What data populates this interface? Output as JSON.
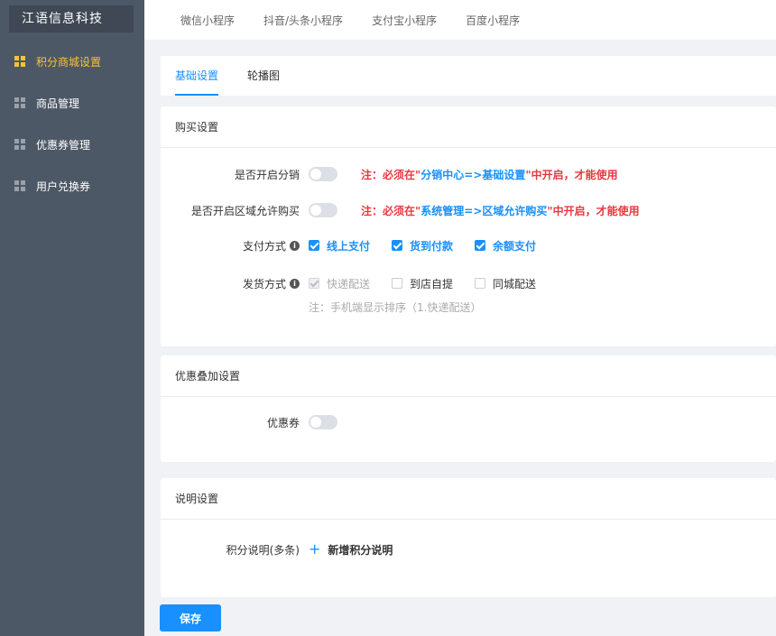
{
  "brand": {
    "title": "江语信息科技"
  },
  "sidebar": {
    "items": [
      {
        "label": "积分商城设置"
      },
      {
        "label": "商品管理"
      },
      {
        "label": "优惠券管理"
      },
      {
        "label": "用户兑换券"
      }
    ]
  },
  "topbar": {
    "tabs": [
      {
        "label": "微信小程序"
      },
      {
        "label": "抖音/头条小程序"
      },
      {
        "label": "支付宝小程序"
      },
      {
        "label": "百度小程序"
      }
    ]
  },
  "subtabs": [
    {
      "label": "基础设置"
    },
    {
      "label": "轮播图"
    }
  ],
  "purchase": {
    "title": "购买设置",
    "distribution": {
      "label": "是否开启分销",
      "note_pre": "注：必须在\"",
      "note_link": "分销中心=>基础设置",
      "note_post": "\"中开启，才能使用"
    },
    "region": {
      "label": "是否开启区域允许购买",
      "note_pre": "注：必须在\"",
      "note_link": "系统管理=>区域允许购买",
      "note_post": "\"中开启，才能使用"
    },
    "payment": {
      "label": "支付方式",
      "options": [
        {
          "label": "线上支付"
        },
        {
          "label": "货到付款"
        },
        {
          "label": "余额支付"
        }
      ]
    },
    "delivery": {
      "label": "发货方式",
      "options": [
        {
          "label": "快递配送"
        },
        {
          "label": "到店自提"
        },
        {
          "label": "同城配送"
        }
      ],
      "hint": "注：手机端显示排序（1.快递配送）"
    }
  },
  "discount": {
    "title": "优惠叠加设置",
    "coupon_label": "优惠券"
  },
  "description": {
    "title": "说明设置",
    "points_label": "积分说明(多条)",
    "add_label": "新增积分说明",
    "add_icon": "+"
  },
  "save_button": {
    "label": "保存"
  },
  "colors": {
    "primary": "#1890ff",
    "sidebar": "#4d5866",
    "active": "#f9c335",
    "warning": "#e8383d"
  }
}
